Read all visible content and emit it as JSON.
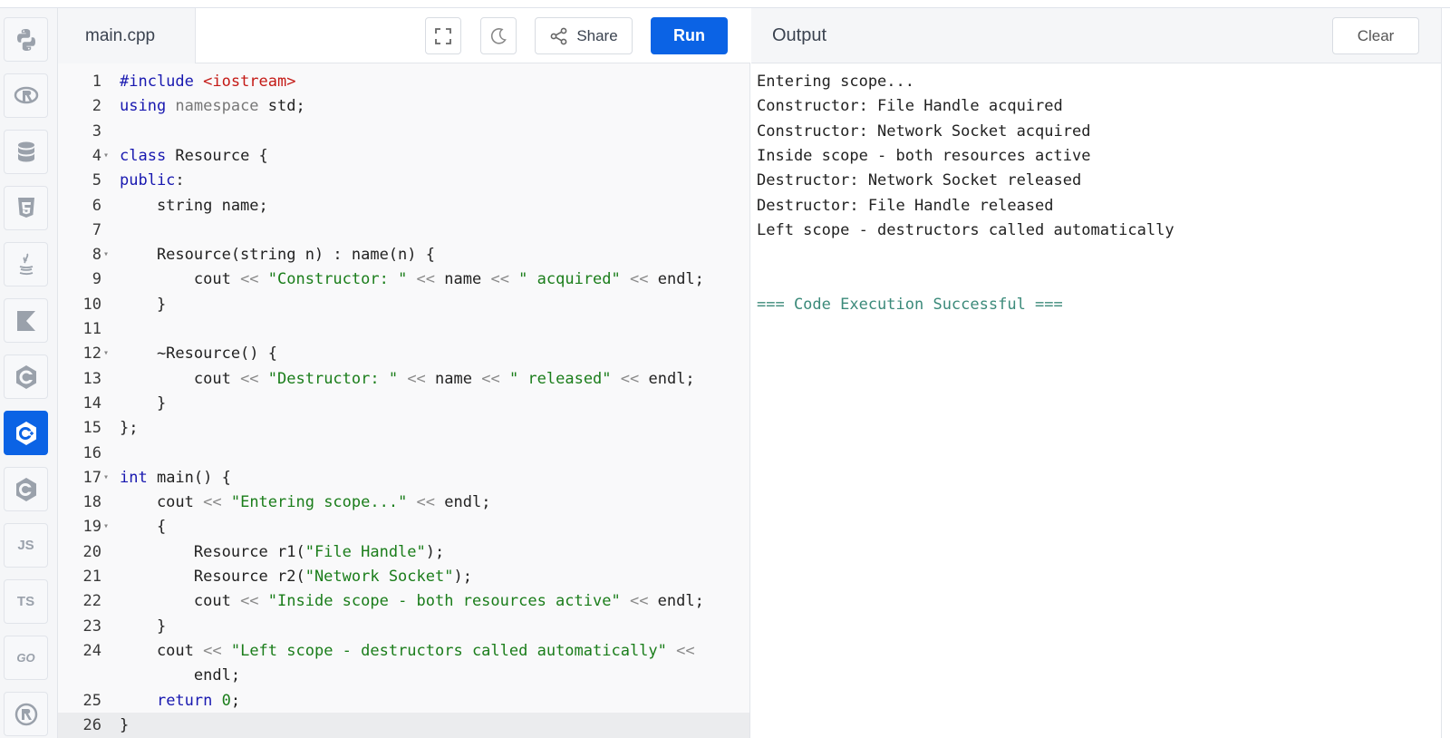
{
  "editor": {
    "file_tab": "main.cpp",
    "share_label": "Share",
    "run_label": "Run",
    "lines": [
      {
        "n": "1",
        "fold": false,
        "parts": [
          [
            "kw",
            "#include "
          ],
          [
            "inc",
            "<iostream>"
          ]
        ]
      },
      {
        "n": "2",
        "fold": false,
        "parts": [
          [
            "kw",
            "using "
          ],
          [
            "gray",
            "namespace "
          ],
          [
            "",
            "std;"
          ]
        ]
      },
      {
        "n": "3",
        "fold": false,
        "parts": []
      },
      {
        "n": "4",
        "fold": true,
        "parts": [
          [
            "kw",
            "class "
          ],
          [
            "",
            "Resource {"
          ]
        ]
      },
      {
        "n": "5",
        "fold": false,
        "parts": [
          [
            "kw",
            "public"
          ],
          [
            "",
            ":"
          ]
        ]
      },
      {
        "n": "6",
        "fold": false,
        "parts": [
          [
            "",
            "    string name;"
          ]
        ]
      },
      {
        "n": "7",
        "fold": false,
        "parts": []
      },
      {
        "n": "8",
        "fold": true,
        "parts": [
          [
            "",
            "    Resource(string n) : name(n) {"
          ]
        ]
      },
      {
        "n": "9",
        "fold": false,
        "parts": [
          [
            "",
            "        cout "
          ],
          [
            "op",
            "<< "
          ],
          [
            "str",
            "\"Constructor: \" "
          ],
          [
            "op",
            "<< "
          ],
          [
            "",
            "name "
          ],
          [
            "op",
            "<< "
          ],
          [
            "str",
            "\" acquired\" "
          ],
          [
            "op",
            "<< "
          ],
          [
            "",
            "endl;"
          ]
        ]
      },
      {
        "n": "10",
        "fold": false,
        "parts": [
          [
            "",
            "    }"
          ]
        ]
      },
      {
        "n": "11",
        "fold": false,
        "parts": []
      },
      {
        "n": "12",
        "fold": true,
        "parts": [
          [
            "",
            "    ~Resource() {"
          ]
        ]
      },
      {
        "n": "13",
        "fold": false,
        "parts": [
          [
            "",
            "        cout "
          ],
          [
            "op",
            "<< "
          ],
          [
            "str",
            "\"Destructor: \" "
          ],
          [
            "op",
            "<< "
          ],
          [
            "",
            "name "
          ],
          [
            "op",
            "<< "
          ],
          [
            "str",
            "\" released\" "
          ],
          [
            "op",
            "<< "
          ],
          [
            "",
            "endl;"
          ]
        ]
      },
      {
        "n": "14",
        "fold": false,
        "parts": [
          [
            "",
            "    }"
          ]
        ]
      },
      {
        "n": "15",
        "fold": false,
        "parts": [
          [
            "",
            "};"
          ]
        ]
      },
      {
        "n": "16",
        "fold": false,
        "parts": []
      },
      {
        "n": "17",
        "fold": true,
        "parts": [
          [
            "kw",
            "int "
          ],
          [
            "",
            "main() {"
          ]
        ]
      },
      {
        "n": "18",
        "fold": false,
        "parts": [
          [
            "",
            "    cout "
          ],
          [
            "op",
            "<< "
          ],
          [
            "str",
            "\"Entering scope...\" "
          ],
          [
            "op",
            "<< "
          ],
          [
            "",
            "endl;"
          ]
        ]
      },
      {
        "n": "19",
        "fold": true,
        "parts": [
          [
            "",
            "    {"
          ]
        ]
      },
      {
        "n": "20",
        "fold": false,
        "parts": [
          [
            "",
            "        Resource r1("
          ],
          [
            "str",
            "\"File Handle\""
          ],
          [
            "",
            ");"
          ]
        ]
      },
      {
        "n": "21",
        "fold": false,
        "parts": [
          [
            "",
            "        Resource r2("
          ],
          [
            "str",
            "\"Network Socket\""
          ],
          [
            "",
            ");"
          ]
        ]
      },
      {
        "n": "22",
        "fold": false,
        "parts": [
          [
            "",
            "        cout "
          ],
          [
            "op",
            "<< "
          ],
          [
            "str",
            "\"Inside scope - both resources active\" "
          ],
          [
            "op",
            "<< "
          ],
          [
            "",
            "endl;"
          ]
        ]
      },
      {
        "n": "23",
        "fold": false,
        "parts": [
          [
            "",
            "    }"
          ]
        ]
      },
      {
        "n": "24",
        "fold": false,
        "parts": [
          [
            "",
            "    cout "
          ],
          [
            "op",
            "<< "
          ],
          [
            "str",
            "\"Left scope - destructors called automatically\" "
          ],
          [
            "op",
            "<<"
          ]
        ]
      },
      {
        "n": "",
        "fold": false,
        "parts": [
          [
            "",
            "        endl;"
          ]
        ]
      },
      {
        "n": "25",
        "fold": false,
        "parts": [
          [
            "",
            "    "
          ],
          [
            "kw",
            "return "
          ],
          [
            "num",
            "0"
          ],
          [
            "",
            ";"
          ]
        ]
      },
      {
        "n": "26",
        "fold": false,
        "parts": [
          [
            "",
            "}"
          ]
        ],
        "highlight": true
      }
    ]
  },
  "output": {
    "title": "Output",
    "clear_label": "Clear",
    "lines": [
      {
        "text": "Entering scope...",
        "type": "normal"
      },
      {
        "text": "Constructor: File Handle acquired",
        "type": "normal"
      },
      {
        "text": "Constructor: Network Socket acquired",
        "type": "normal"
      },
      {
        "text": "Inside scope - both resources active",
        "type": "normal"
      },
      {
        "text": "Destructor: Network Socket released",
        "type": "normal"
      },
      {
        "text": "Destructor: File Handle released",
        "type": "normal"
      },
      {
        "text": "Left scope - destructors called automatically",
        "type": "normal"
      },
      {
        "text": "",
        "type": "normal"
      },
      {
        "text": "",
        "type": "normal"
      },
      {
        "text": "=== Code Execution Successful ===",
        "type": "success"
      }
    ]
  },
  "sidebar": {
    "items": [
      {
        "icon": "python-icon",
        "active": false
      },
      {
        "icon": "r-icon",
        "active": false
      },
      {
        "icon": "sql-icon",
        "active": false
      },
      {
        "icon": "html5-icon",
        "active": false
      },
      {
        "icon": "java-icon",
        "active": false
      },
      {
        "icon": "kotlin-icon",
        "active": false
      },
      {
        "icon": "c-icon",
        "active": false
      },
      {
        "icon": "cpp-icon",
        "active": true
      },
      {
        "icon": "csharp-icon",
        "active": false
      },
      {
        "icon": "javascript-icon",
        "active": false,
        "text": "JS"
      },
      {
        "icon": "typescript-icon",
        "active": false,
        "text": "TS"
      },
      {
        "icon": "go-icon",
        "active": false,
        "text": "GO"
      },
      {
        "icon": "rust-icon",
        "active": false
      }
    ]
  },
  "colors": {
    "accent": "#0b63e5",
    "keyword": "#1818b0",
    "string": "#1a7d1a",
    "include": "#c41a16",
    "success": "#3b8a7a"
  }
}
